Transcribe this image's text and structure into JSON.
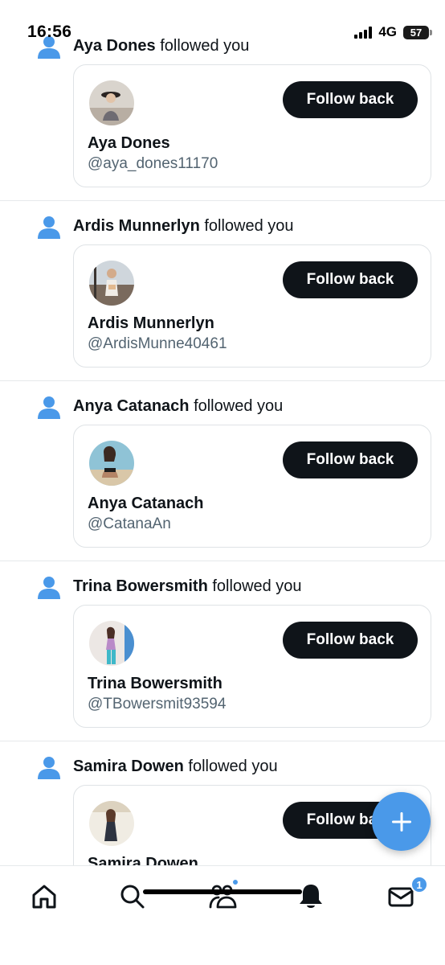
{
  "status_bar": {
    "time": "16:56",
    "network": "4G",
    "battery": "57"
  },
  "follow_suffix": "followed you",
  "notifications": [
    {
      "name": "Aya Dones",
      "handle": "@aya_dones11170",
      "button": "Follow back"
    },
    {
      "name": "Ardis Munnerlyn",
      "handle": "@ArdisMunne40461",
      "button": "Follow back"
    },
    {
      "name": "Anya Catanach",
      "handle": "@CatanaAn",
      "button": "Follow back"
    },
    {
      "name": "Trina Bowersmith",
      "handle": "@TBowersmit93594",
      "button": "Follow back"
    },
    {
      "name": "Samira Dowen",
      "handle": "",
      "button": "Follow back"
    }
  ],
  "icons": {
    "notification_type": "person-icon",
    "compose": "plus-icon",
    "tabs": [
      "home-icon",
      "search-icon",
      "communities-icon",
      "bell-icon",
      "mail-icon"
    ]
  },
  "tab_bar": {
    "mail_badge": "1",
    "communities_has_dot": true
  },
  "colors": {
    "accent": "#4a99e9",
    "button_bg": "#0f1419",
    "handle": "#536471",
    "border": "#dfe3e6"
  }
}
